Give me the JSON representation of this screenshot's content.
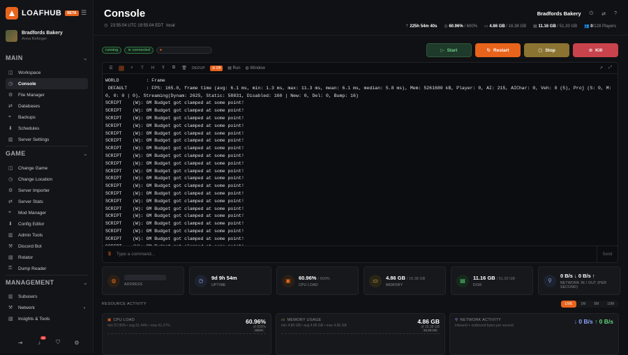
{
  "app": {
    "name": "LOAFHUB",
    "badge": "BETA"
  },
  "server": {
    "name": "Bradfords Bakery",
    "subtitle": "Arma Reforger"
  },
  "sections": {
    "main": {
      "title": "MAIN",
      "items": [
        "Workspace",
        "Console",
        "File Manager",
        "Databases",
        "Backups",
        "Schedules",
        "Server Settings"
      ]
    },
    "game": {
      "title": "GAME",
      "items": [
        "Change Game",
        "Change Location",
        "Server Importer",
        "Server Stats",
        "Mod Manager",
        "Config Editor",
        "Admin Tools",
        "Discord Bot",
        "Rotator",
        "Dump Reader"
      ]
    },
    "management": {
      "title": "MANAGEMENT",
      "items": [
        "Subusers",
        "Network",
        "Insights & Tools"
      ]
    }
  },
  "active_item": "Console",
  "notifications_count": "20",
  "header": {
    "title": "Console",
    "time": "23:55:04 UTC  19:55:04 EDT",
    "time_suffix": "local",
    "server_name": "Bradfords Bakery",
    "uptime": "225h 54m 40s",
    "cpu": "60.96%",
    "cpu_max": "/ 600%",
    "mem": "4.86 GB",
    "mem_max": "/ 16.38 GB",
    "disk": "11.16 GB",
    "disk_max": "/ 51.20 GB",
    "players": "0",
    "players_max": "/128 Players"
  },
  "status": {
    "running": "running",
    "connected": "connected"
  },
  "actions": {
    "start": "Start",
    "restart": "Restart",
    "stop": "Stop",
    "kill": "Kill"
  },
  "console": {
    "toolbar": {
      "dedup": "DEDUP",
      "dedup_state": "Off",
      "run": "Run",
      "window": "Window"
    },
    "lines": [
      "WORLD          : Frame",
      " DEFAULT       : FPS: 165.0, frame time (avg: 6.1 ms, min: 1.3 ms, max: 11.3 ms, mean: 6.1 ms, median: 5.8 ms), Mem: 5261680 kB, Player: 0, AI: 215, AIChar: 0, Veh: 0 (5), Proj (S: 0, M:",
      "0, 0: 0 | 0), Streaming(Dynam: 2625, Static: 58831, Disabled: 160 | New: 0, Del: 0, Bump: 16)",
      "SCRIPT    (W): GM Budget got clamped at some point!",
      "SCRIPT    (W): GM Budget got clamped at some point!",
      "SCRIPT    (W): GM Budget got clamped at some point!",
      "SCRIPT    (W): GM Budget got clamped at some point!",
      "SCRIPT    (W): GM Budget got clamped at some point!",
      "SCRIPT    (W): GM Budget got clamped at some point!",
      "SCRIPT    (W): GM Budget got clamped at some point!",
      "SCRIPT    (W): GM Budget got clamped at some point!",
      "SCRIPT    (W): GM Budget got clamped at some point!",
      "SCRIPT    (W): GM Budget got clamped at some point!",
      "SCRIPT    (W): GM Budget got clamped at some point!",
      "SCRIPT    (W): GM Budget got clamped at some point!",
      "SCRIPT    (W): GM Budget got clamped at some point!",
      "SCRIPT    (W): GM Budget got clamped at some point!",
      "SCRIPT    (W): GM Budget got clamped at some point!",
      "SCRIPT    (W): GM Budget got clamped at some point!",
      "SCRIPT    (W): GM Budget got clamped at some point!",
      "SCRIPT    (W): GM Budget got clamped at some point!",
      "SCRIPT    (W): GM Budget got clamped at some point!",
      "SCRIPT    (W): GM Budget got clamped at some point!"
    ],
    "placeholder": "Type a command...",
    "send": "Send"
  },
  "cards": {
    "address_label": "ADDRESS",
    "uptime_value": "9d 9h 54m",
    "uptime_label": "UPTIME",
    "cpu_value": "60.96%",
    "cpu_max": "/ 600%",
    "cpu_label": "CPU LOAD",
    "mem_value": "4.86 GB",
    "mem_max": "/ 16.38 GB",
    "mem_label": "MEMORY",
    "disk_value": "11.16 GB",
    "disk_max": "/ 51.20 GB",
    "disk_label": "DISK",
    "net_value": "0 B/s ↓ 0 B/s ↑",
    "net_label": "NETWORK IN / OUT (PER SECOND)"
  },
  "resource": {
    "title": "RESOURCE ACTIVITY",
    "ranges": [
      "LIVE",
      "1M",
      "5M",
      "10M"
    ],
    "cpu": {
      "label": "CPU LOAD",
      "value": "60.96%",
      "of": "of 600%",
      "sub": "min 57.06% • avg 61.44% • max 61.27%",
      "cap": "600%"
    },
    "memory": {
      "label": "MEMORY USAGE",
      "value": "4.86 GB",
      "of": "of 16.38 GB",
      "sub": "min 4.86 GB • avg 4.86 GB • max 4.86 GB",
      "cap": "16.38 GB"
    },
    "network": {
      "label": "NETWORK ACTIVITY",
      "down": "↓ 0 B/s",
      "up": "↑ 0 B/s",
      "sub": "inbound + outbound bytes per second"
    }
  }
}
